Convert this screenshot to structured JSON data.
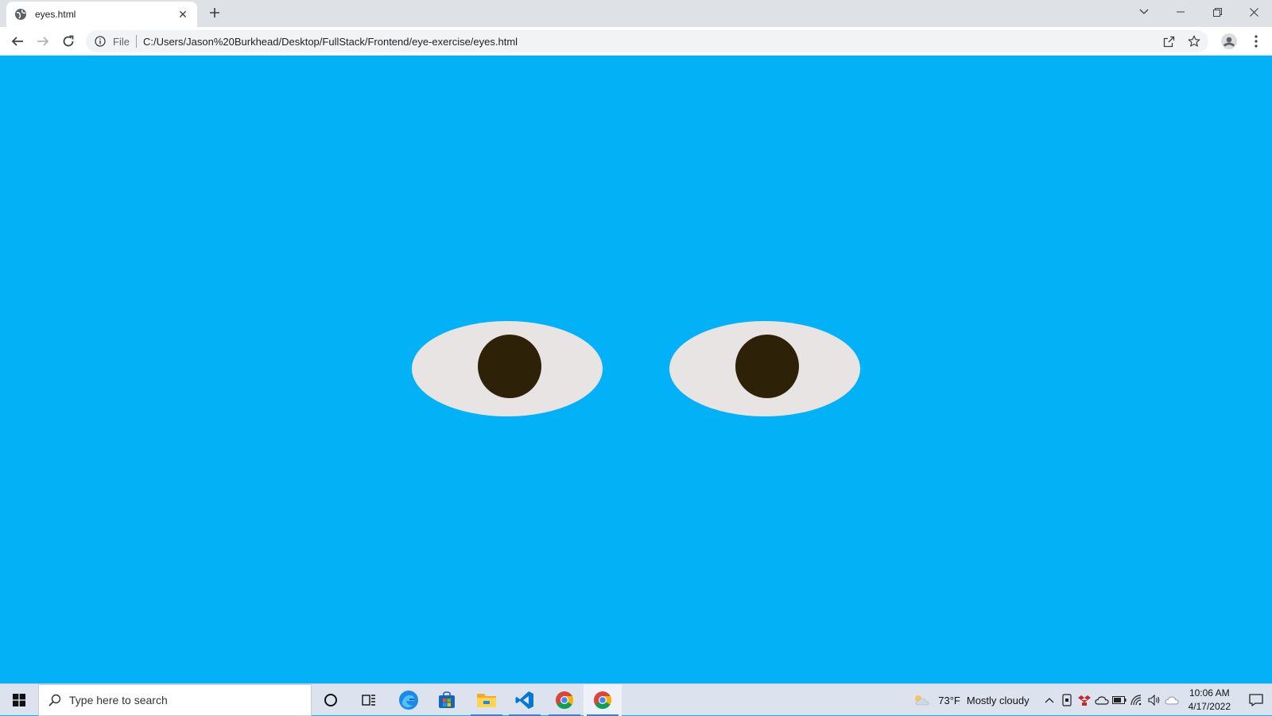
{
  "browser": {
    "tab": {
      "title": "eyes.html",
      "close_glyph": "✕"
    },
    "new_tab_glyph": "+",
    "window_controls": {
      "tabsearch": "⌄",
      "minimize": "—",
      "restore": "❐",
      "close": "✕"
    },
    "omnibox": {
      "scheme": "File",
      "url": "C:/Users/Jason%20Burkhead/Desktop/FullStack/Frontend/eye-exercise/eyes.html"
    }
  },
  "page": {
    "background": "#03b1f7",
    "eye_color": "#e8e4e4",
    "pupil_color": "#2d2208"
  },
  "taskbar": {
    "search_placeholder": "Type here to search",
    "weather": {
      "temp": "73°F",
      "condition": "Mostly cloudy"
    },
    "clock": {
      "time": "10:06 AM",
      "date": "4/17/2022"
    }
  }
}
